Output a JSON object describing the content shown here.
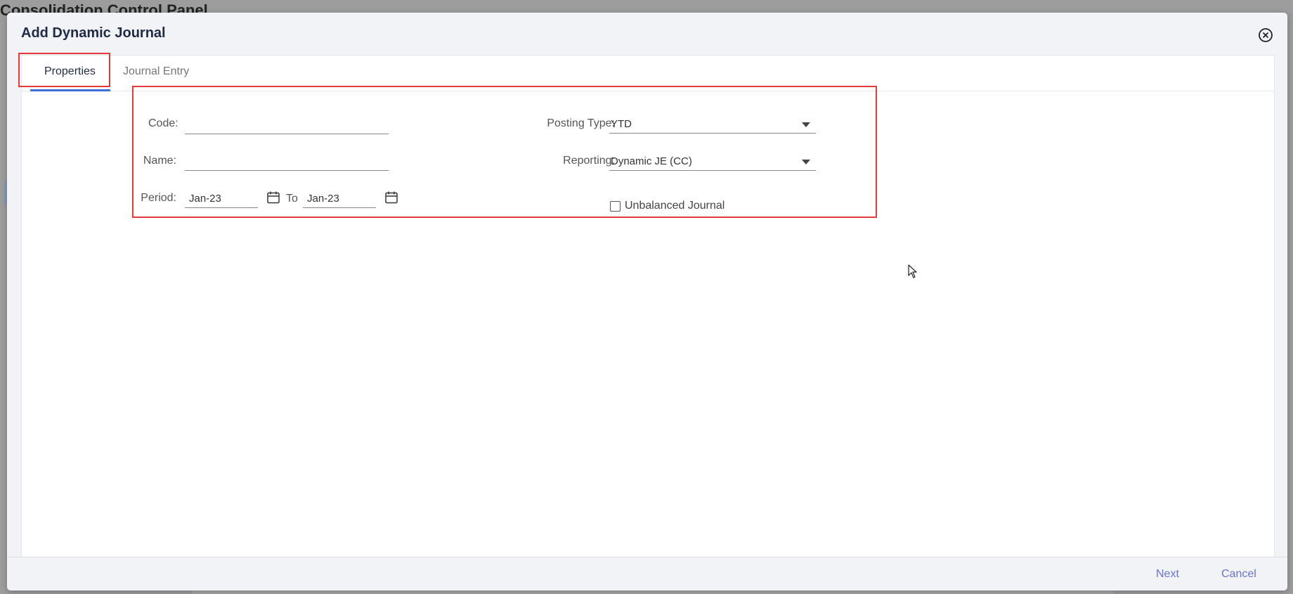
{
  "background": {
    "title": "Consolidation Control Panel"
  },
  "dialog": {
    "title": "Add Dynamic Journal",
    "close_icon": "close-circle-icon"
  },
  "tabs": [
    {
      "label": "Properties",
      "active": true
    },
    {
      "label": "Journal Entry",
      "active": false
    }
  ],
  "form": {
    "code_label": "Code:",
    "code_value": "",
    "name_label": "Name:",
    "name_value": "",
    "period_label": "Period:",
    "period_from": "Jan-23",
    "period_to_label": "To",
    "period_to": "Jan-23",
    "posting_type_label": "Posting Type:",
    "posting_type_value": "YTD",
    "reporting_label": "Reporting:",
    "reporting_value": "Dynamic JE (CC)",
    "unbalanced_label": "Unbalanced Journal",
    "unbalanced_checked": false
  },
  "footer": {
    "next_label": "Next",
    "cancel_label": "Cancel"
  },
  "colors": {
    "highlight": "#e63a3a",
    "tab_accent": "#3d6fd6",
    "link": "#6a73c9"
  }
}
